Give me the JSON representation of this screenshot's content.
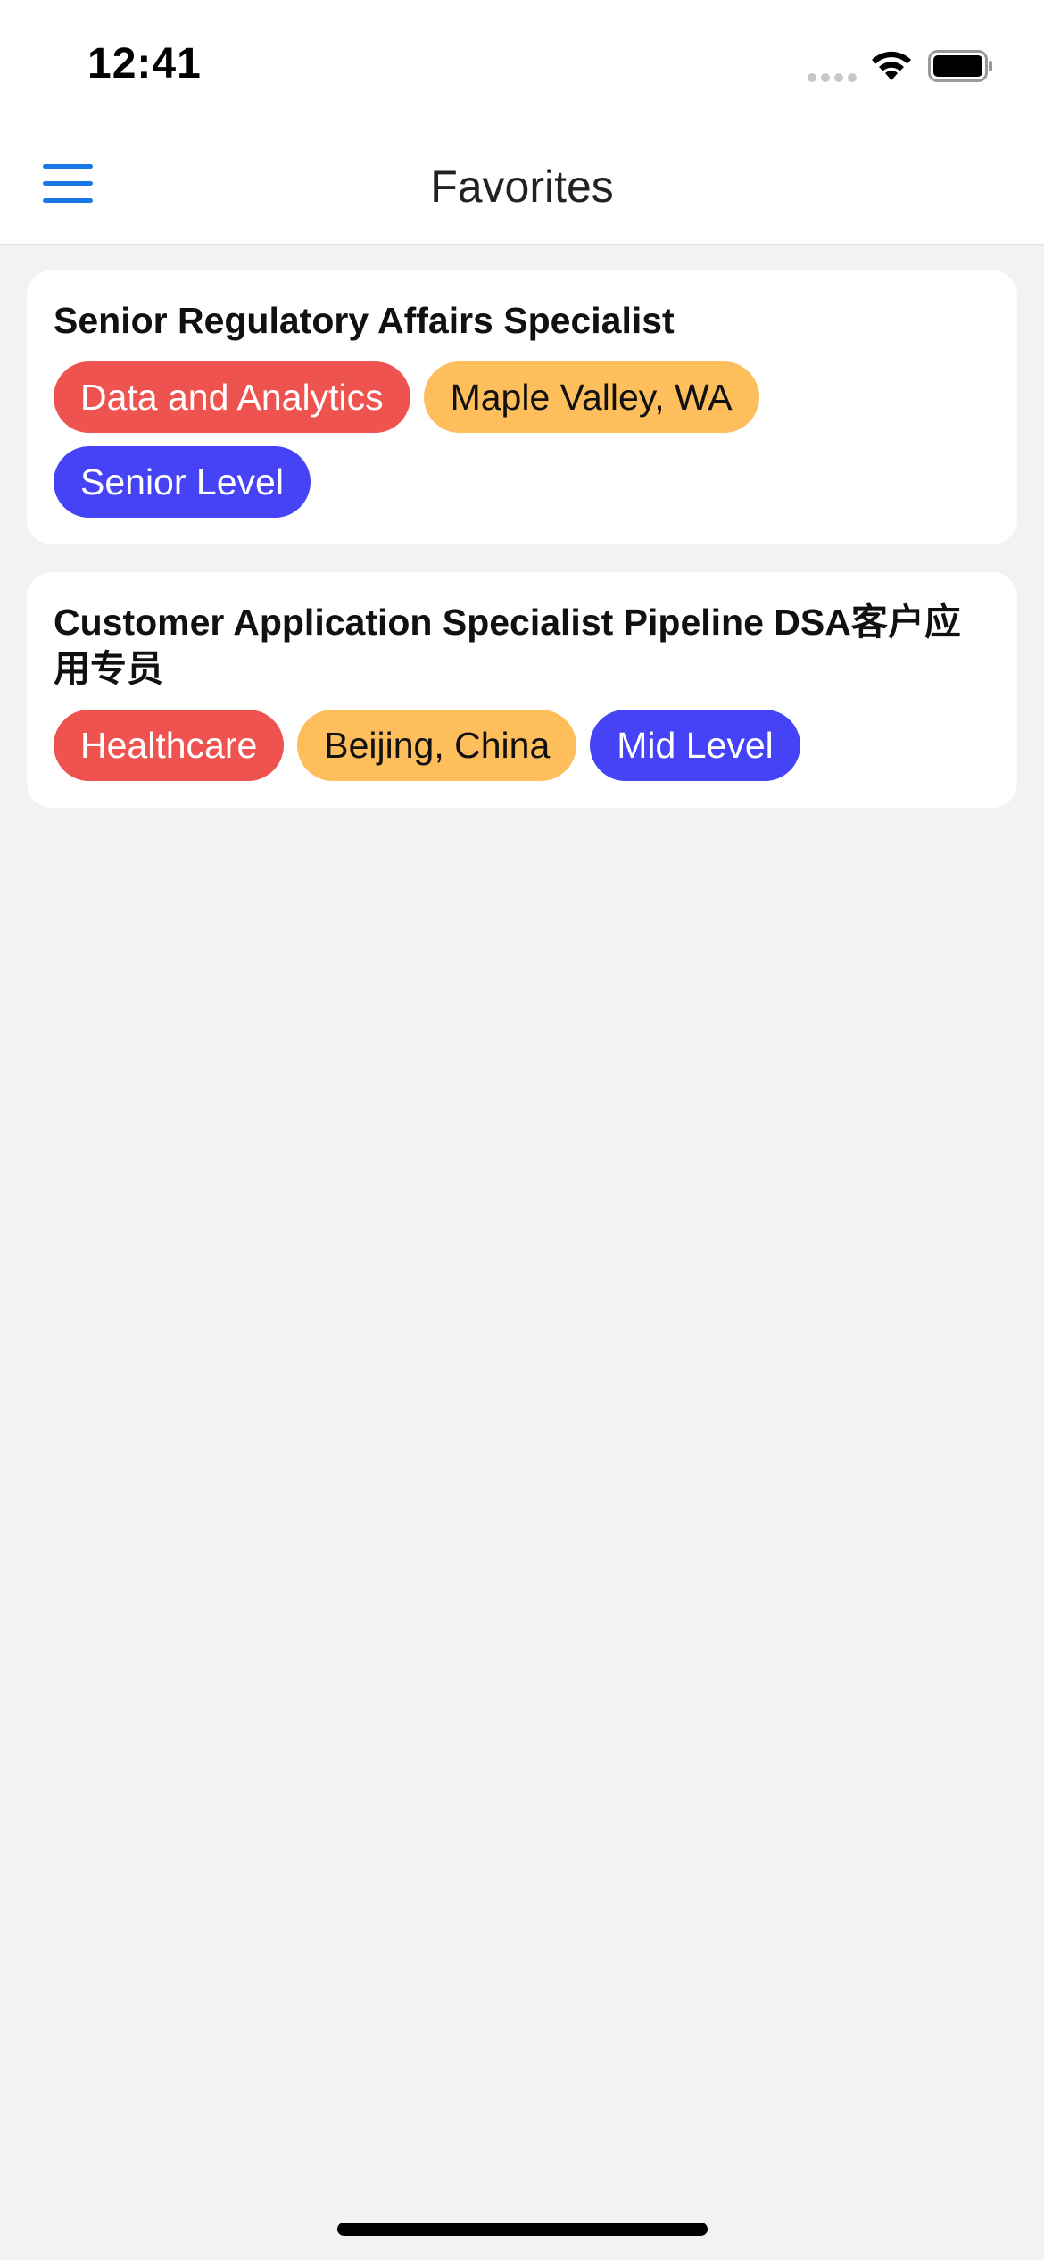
{
  "status_bar": {
    "time": "12:41"
  },
  "header": {
    "title": "Favorites",
    "menu_icon": "hamburger-menu-icon"
  },
  "colors": {
    "accent": "#1878e8",
    "industry_tag": "#ef5350",
    "location_tag": "#ffbe5c",
    "level_tag": "#4543f5"
  },
  "favorites": [
    {
      "title": "Senior Regulatory Affairs Specialist",
      "industry": "Data and Analytics",
      "location": "Maple Valley, WA",
      "level": "Senior Level"
    },
    {
      "title": "Customer Application Specialist Pipeline DSA客户应用专员",
      "industry": "Healthcare",
      "location": "Beijing, China",
      "level": "Mid Level"
    }
  ]
}
